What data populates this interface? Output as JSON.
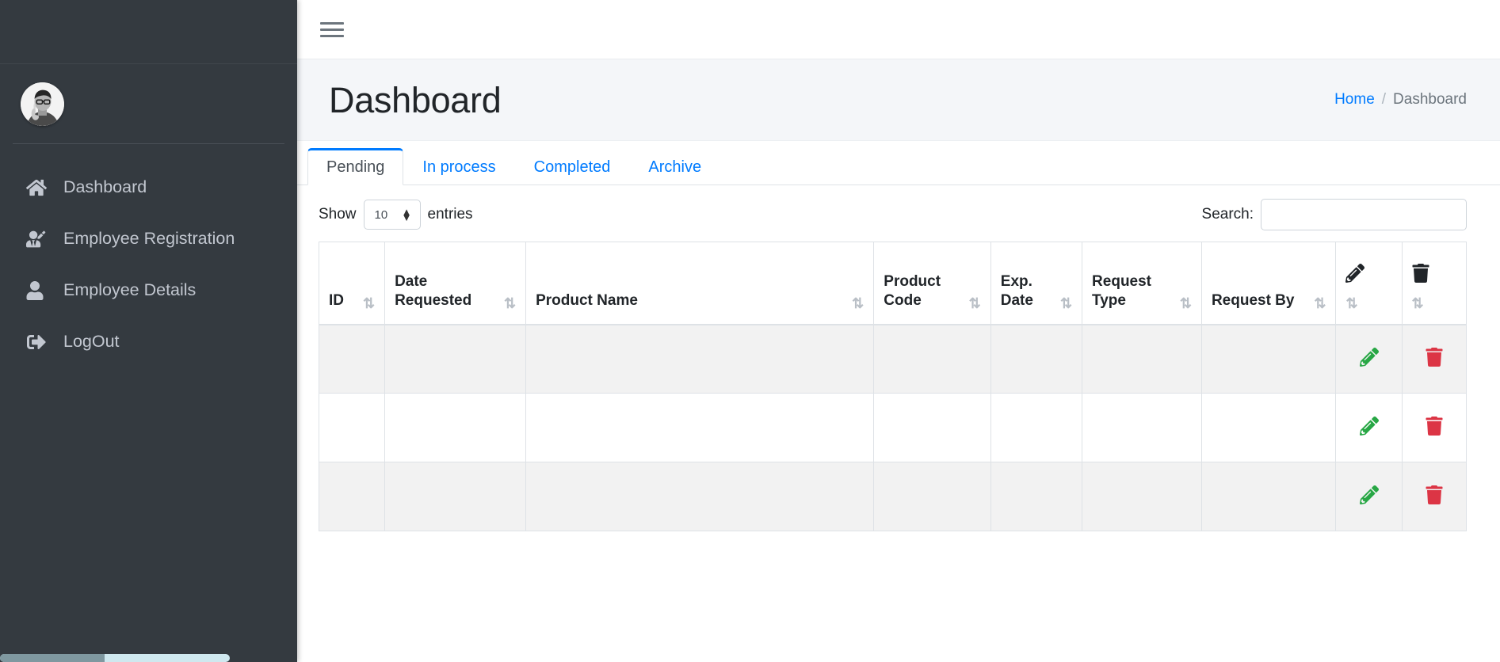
{
  "sidebar": {
    "avatar_alt": "user-avatar",
    "items": [
      {
        "label": "Dashboard",
        "icon": "home-icon"
      },
      {
        "label": "Employee Registration",
        "icon": "user-edit-icon"
      },
      {
        "label": "Employee Details",
        "icon": "user-icon"
      },
      {
        "label": "LogOut",
        "icon": "logout-icon"
      }
    ]
  },
  "topbar": {
    "menu_icon": "hamburger-icon"
  },
  "page": {
    "title": "Dashboard",
    "breadcrumb": {
      "home": "Home",
      "separator": "/",
      "current": "Dashboard"
    }
  },
  "tabs": [
    {
      "label": "Pending",
      "active": true
    },
    {
      "label": "In process",
      "active": false
    },
    {
      "label": "Completed",
      "active": false
    },
    {
      "label": "Archive",
      "active": false
    }
  ],
  "tools": {
    "show_label": "Show",
    "entries_value": "10",
    "entries_label": "entries",
    "search_label": "Search:",
    "search_value": "",
    "search_placeholder": ""
  },
  "table": {
    "columns": [
      {
        "label": "ID",
        "sortable": true,
        "icon": null
      },
      {
        "label": "Date Requested",
        "sortable": true,
        "icon": null
      },
      {
        "label": "Product Name",
        "sortable": true,
        "icon": null
      },
      {
        "label": "Product Code",
        "sortable": true,
        "icon": null
      },
      {
        "label": "Exp. Date",
        "sortable": true,
        "icon": null
      },
      {
        "label": "Request Type",
        "sortable": true,
        "icon": null
      },
      {
        "label": "Request By",
        "sortable": true,
        "icon": null
      },
      {
        "label": "",
        "sortable": true,
        "icon": "edit-icon"
      },
      {
        "label": "",
        "sortable": true,
        "icon": "trash-icon"
      }
    ],
    "rows": [
      {
        "id": "",
        "date_requested": "",
        "product_name": "",
        "product_code": "",
        "exp_date": "",
        "request_type": "",
        "request_by": ""
      },
      {
        "id": "",
        "date_requested": "",
        "product_name": "",
        "product_code": "",
        "exp_date": "",
        "request_type": "",
        "request_by": ""
      },
      {
        "id": "",
        "date_requested": "",
        "product_name": "",
        "product_code": "",
        "exp_date": "",
        "request_type": "",
        "request_by": ""
      }
    ],
    "row_actions": {
      "edit_icon": "edit-icon",
      "delete_icon": "trash-icon"
    }
  },
  "colors": {
    "sidebar_bg": "#343a40",
    "accent": "#007bff",
    "page_head_bg": "#f4f6f9",
    "edit_green": "#28a745",
    "delete_red": "#dc3545",
    "stripe": "#f2f2f2"
  }
}
